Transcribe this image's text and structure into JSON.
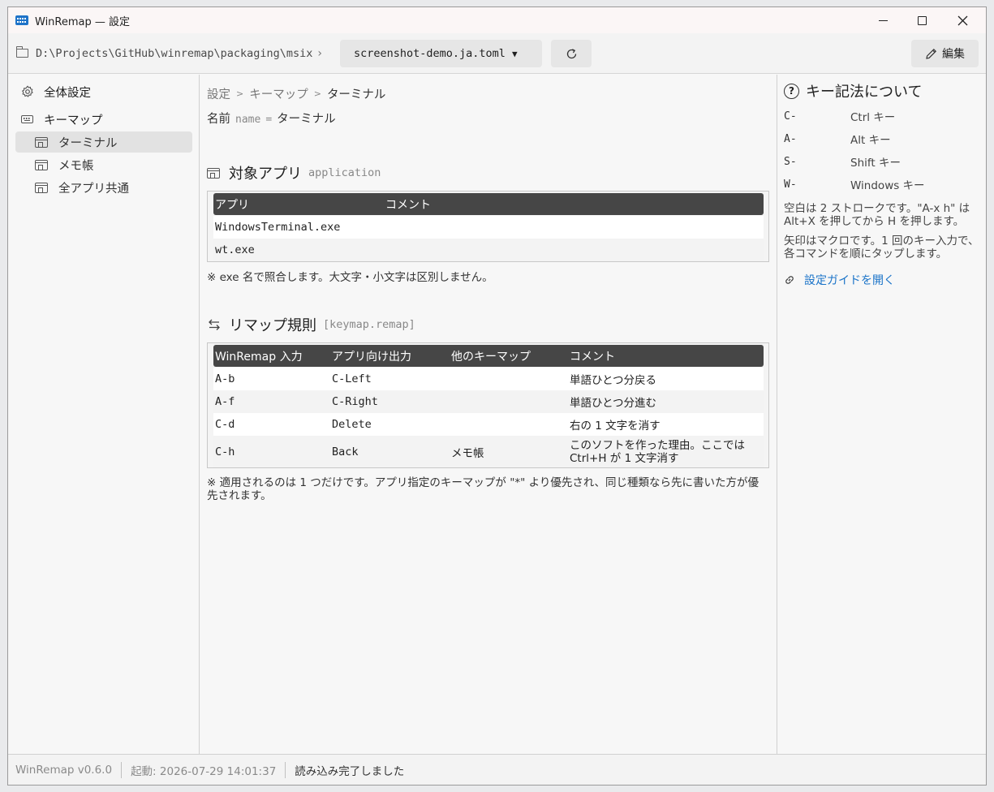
{
  "window": {
    "title": "WinRemap — 設定"
  },
  "toolbar": {
    "path": "D:\\Projects\\GitHub\\winremap\\packaging\\msix",
    "path_chevron": "›",
    "file": "screenshot-demo.ja.toml",
    "edit_label": "編集"
  },
  "sidebar": {
    "global_settings": "全体設定",
    "keymap_group": "キーマップ",
    "keymaps": [
      "ターミナル",
      "メモ帳",
      "全アプリ共通"
    ]
  },
  "main": {
    "breadcrumb": [
      "設定",
      "キーマップ",
      "ターミナル"
    ],
    "name_label": "名前",
    "name_key": "name",
    "name_eq": "=",
    "name_value": "ターミナル",
    "apps_title": "対象アプリ",
    "apps_key": "application",
    "apps_headers": [
      "アプリ",
      "コメント"
    ],
    "apps_rows": [
      {
        "app": "WindowsTerminal.exe",
        "comment": ""
      },
      {
        "app": "wt.exe",
        "comment": ""
      }
    ],
    "apps_note": "※ exe 名で照合します。大文字・小文字は区別しません。",
    "remap_title": "リマップ規則",
    "remap_key": "[keymap.remap]",
    "remap_headers": [
      "WinRemap 入力",
      "アプリ向け出力",
      "他のキーマップ",
      "コメント"
    ],
    "remap_rows": [
      {
        "input": "A-b",
        "output": "C-Left",
        "other": "",
        "comment": "単語ひとつ分戻る"
      },
      {
        "input": "A-f",
        "output": "C-Right",
        "other": "",
        "comment": "単語ひとつ分進む"
      },
      {
        "input": "C-d",
        "output": "Delete",
        "other": "",
        "comment": "右の 1 文字を消す"
      },
      {
        "input": "C-h",
        "output": "Back",
        "other": "メモ帳",
        "comment": "このソフトを作った理由。ここでは Ctrl+H が 1 文字消す"
      }
    ],
    "remap_note": "※ 適用されるのは 1 つだけです。アプリ指定のキーマップが \"*\" より優先され、同じ種類なら先に書いた方が優先されます。"
  },
  "help": {
    "title": "キー記法について",
    "keys": [
      {
        "k": "C-",
        "desc": "Ctrl キー"
      },
      {
        "k": "A-",
        "desc": "Alt キー"
      },
      {
        "k": "S-",
        "desc": "Shift キー"
      },
      {
        "k": "W-",
        "desc": "Windows キー"
      }
    ],
    "para1": "空白は 2 ストロークです。\"A-x h\" は Alt+X を押してから H を押します。",
    "para2": "矢印はマクロです。1 回のキー入力で、各コマンドを順にタップします。",
    "guide_link": "設定ガイドを開く"
  },
  "status": {
    "version": "WinRemap v0.6.0",
    "started": "起動: 2026-07-29 14:01:37",
    "message": "読み込み完了しました"
  },
  "colors": {
    "accent": "#1a73c8",
    "table_header": "#464646",
    "app_icon": "#1e73c8"
  },
  "icons": {
    "app": "winremap-app-icon",
    "folder": "folder-icon",
    "refresh": "refresh-icon",
    "edit": "pencil-icon",
    "settings": "gear-icon",
    "keymap": "keyboard-icon",
    "window": "window-icon",
    "remap": "swap-arrows-icon",
    "help": "question-icon",
    "link": "link-icon"
  }
}
